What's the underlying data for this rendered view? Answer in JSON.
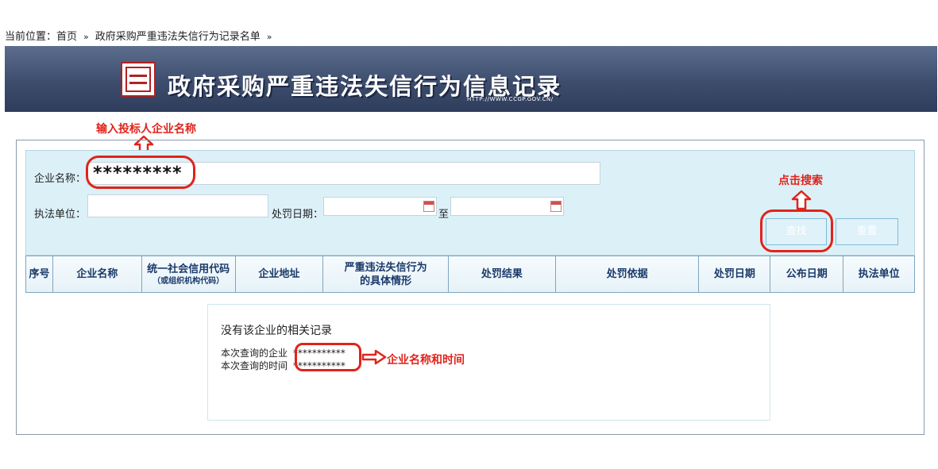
{
  "breadcrumb": {
    "prefix": "当前位置：",
    "home": "首页",
    "sep1": "»",
    "current": "政府采购严重违法失信行为记录名单",
    "sep2": "»"
  },
  "banner": {
    "title": "政府采购严重违法失信行为信息记录",
    "url": "HTTP://WWW.CCGP.GOV.CN/"
  },
  "annotations": {
    "enter_name": "输入投标人企业名称",
    "click_search": "点击搜索",
    "name_and_time": "企业名称和时间",
    "color": "#e0241b"
  },
  "search": {
    "company_label": "企业名称：",
    "company_value": "*********",
    "unit_label": "执法单位：",
    "unit_value": "",
    "date_label": "处罚日期：",
    "date_from": "",
    "date_to_label": "至",
    "date_to": "",
    "search_button": "查找",
    "reset_button": "重置"
  },
  "table": {
    "columns": [
      {
        "label": "序号",
        "sub": ""
      },
      {
        "label": "企业名称",
        "sub": ""
      },
      {
        "label": "统一社会信用代码",
        "sub": "（或组织机构代码）"
      },
      {
        "label": "企业地址",
        "sub": ""
      },
      {
        "label": "严重违法失信行为\n的具体情形",
        "sub": ""
      },
      {
        "label": "处罚结果",
        "sub": ""
      },
      {
        "label": "处罚依据",
        "sub": ""
      },
      {
        "label": "处罚日期",
        "sub": ""
      },
      {
        "label": "公布日期",
        "sub": ""
      },
      {
        "label": "执法单位",
        "sub": ""
      }
    ]
  },
  "result": {
    "message": "没有该企业的相关记录",
    "company_label": "本次查询的企业",
    "company_value": "***********",
    "time_label": "本次查询的时间",
    "time_value": "***********"
  },
  "colors": {
    "banner_dark": "#2f3d5c",
    "search_bg": "#dcf0f8",
    "header_text": "#1a3a6a"
  }
}
